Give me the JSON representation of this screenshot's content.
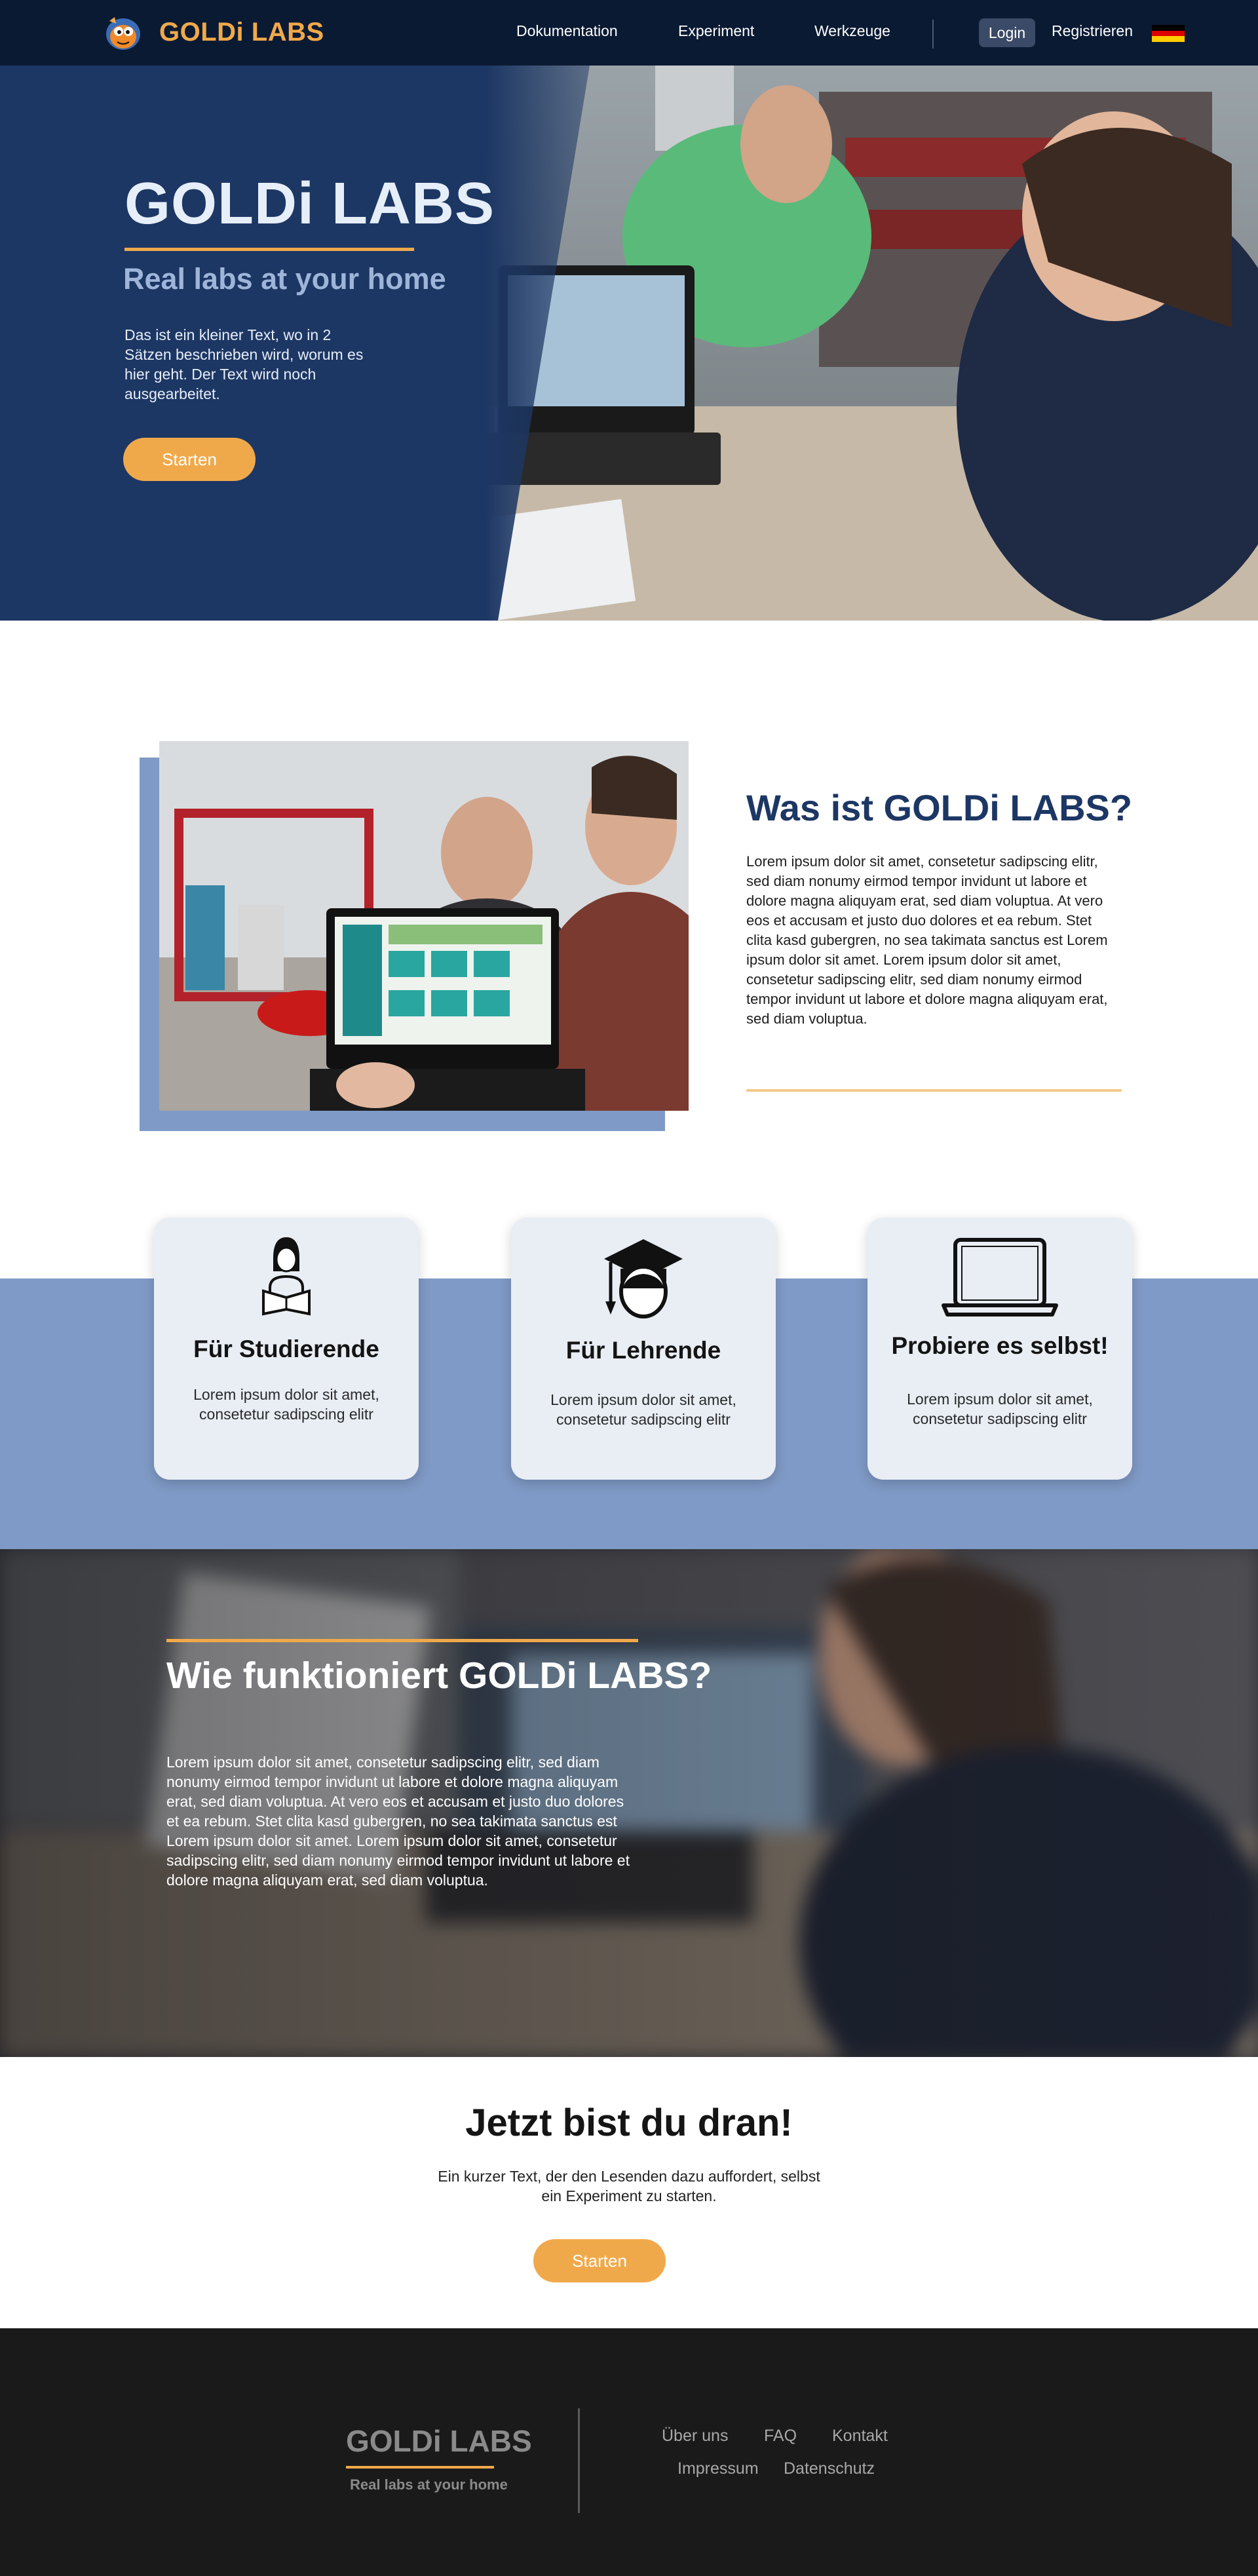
{
  "nav": {
    "brand": "GOLDi LABS",
    "links": [
      "Dokumentation",
      "Experiment",
      "Werkzeuge"
    ],
    "login": "Login",
    "register": "Registrieren",
    "language_flag": "de-flag-icon"
  },
  "hero": {
    "title": "GOLDi LABS",
    "subtitle": "Real labs at your home",
    "description": "Das ist ein kleiner Text, wo in 2 Sätzen beschrieben wird, worum es hier geht. Der Text wird noch ausgearbeitet.",
    "button": "Starten"
  },
  "about": {
    "title": "Was ist GOLDi LABS?",
    "text": "Lorem ipsum dolor sit amet, consetetur sadipscing elitr, sed diam nonumy eirmod tempor invidunt ut labore et dolore magna aliquyam erat, sed diam voluptua. At vero eos et accusam et justo duo dolores et ea rebum. Stet clita kasd gubergren, no sea takimata sanctus est Lorem ipsum dolor sit amet. Lorem ipsum dolor sit amet, consetetur sadipscing elitr, sed diam nonumy eirmod tempor invidunt ut labore et dolore magna aliquyam erat, sed diam voluptua."
  },
  "features": [
    {
      "icon": "student-reading-icon",
      "title": "Für Studierende",
      "text": "Lorem ipsum dolor sit amet, consetetur sadipscing elitr"
    },
    {
      "icon": "graduate-cap-icon",
      "title": "Für Lehrende",
      "text": "Lorem ipsum dolor sit amet, consetetur sadipscing elitr"
    },
    {
      "icon": "laptop-icon",
      "title": "Probiere es selbst!",
      "text": "Lorem ipsum dolor sit amet, consetetur sadipscing elitr"
    }
  ],
  "how": {
    "title": "Wie funktioniert GOLDi LABS?",
    "text": "Lorem ipsum dolor sit amet, consetetur sadipscing elitr, sed diam nonumy eirmod tempor invidunt ut labore et dolore magna aliquyam erat, sed diam voluptua. At vero eos et accusam et justo duo dolores et ea rebum. Stet clita kasd gubergren, no sea takimata sanctus est Lorem ipsum dolor sit amet. Lorem ipsum dolor sit amet, consetetur sadipscing elitr, sed diam nonumy eirmod tempor invidunt ut labore et dolore magna aliquyam erat, sed diam voluptua."
  },
  "cta": {
    "title": "Jetzt bist du dran!",
    "text": "Ein kurzer Text, der den Lesenden dazu auffordert, selbst ein Experiment zu starten.",
    "button": "Starten"
  },
  "footer": {
    "brand": "GOLDi LABS",
    "tagline": "Real labs at your home",
    "links_row1": [
      "Über uns",
      "FAQ",
      "Kontakt"
    ],
    "links_row2": [
      "Impressum",
      "Datenschutz"
    ]
  },
  "colors": {
    "nav_bg": "#0b1a33",
    "primary_dark": "#1d3764",
    "accent_orange": "#f0a94a",
    "band_blue": "#7f9ac6",
    "footer_bg": "#1a1a1a"
  }
}
